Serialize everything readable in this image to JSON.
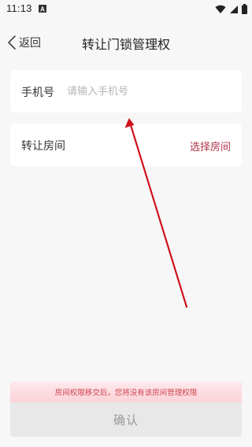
{
  "status_bar": {
    "time": "11:13",
    "notification_icon": "a-box-icon",
    "icons": [
      "wifi-icon",
      "signal-icon",
      "battery-icon"
    ]
  },
  "nav": {
    "back_label": "返回",
    "title": "转让门锁管理权"
  },
  "phone": {
    "label": "手机号",
    "placeholder": "请输入手机号",
    "value": ""
  },
  "room": {
    "label": "转让房间",
    "action": "选择房间"
  },
  "warning": {
    "text": "房间权限移交后，您将没有该房间管理权限"
  },
  "confirm": {
    "label": "确认"
  },
  "colors": {
    "accent": "#b0334a",
    "warning_text": "#d0424e",
    "annotation_arrow": "#d0121b",
    "background": "#f7f7f7"
  }
}
